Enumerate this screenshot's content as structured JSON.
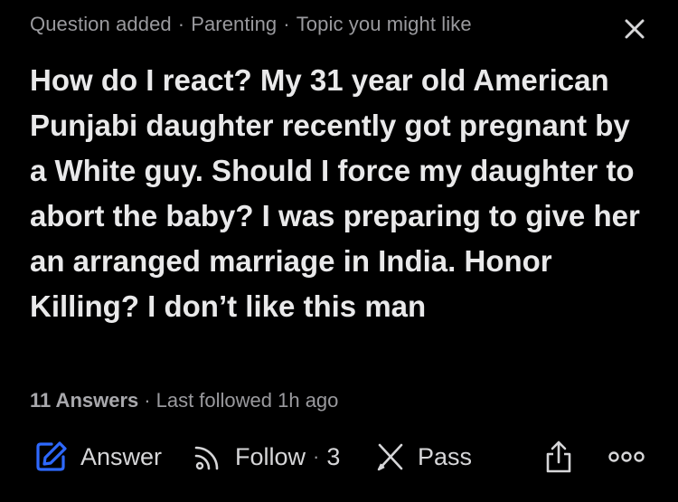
{
  "header": {
    "status": "Question added",
    "topic": "Parenting",
    "reason": "Topic you might like",
    "separator": "·",
    "close_icon": "close-icon"
  },
  "question": {
    "title": "How do I react? My 31 year old American Punjabi daughter recently got pregnant by a White guy. Should I force my daughter to abort the baby? I was preparing to give her an arranged marriage in India. Honor Killing? I don’t like this man"
  },
  "stats": {
    "answers": "11 Answers",
    "separator": "·",
    "last_followed": "Last followed 1h ago"
  },
  "actions": {
    "answer_label": "Answer",
    "follow_label": "Follow",
    "follow_separator": "·",
    "follow_count": "3",
    "pass_label": "Pass",
    "answer_icon": "pencil-icon",
    "follow_icon": "rss-icon",
    "pass_icon": "pass-icon",
    "share_icon": "share-icon",
    "more_icon": "more-icon"
  },
  "colors": {
    "background": "#000000",
    "title_text": "#e9e9ea",
    "meta_text": "#9a9a9e",
    "accent_blue": "#2e69ff"
  }
}
